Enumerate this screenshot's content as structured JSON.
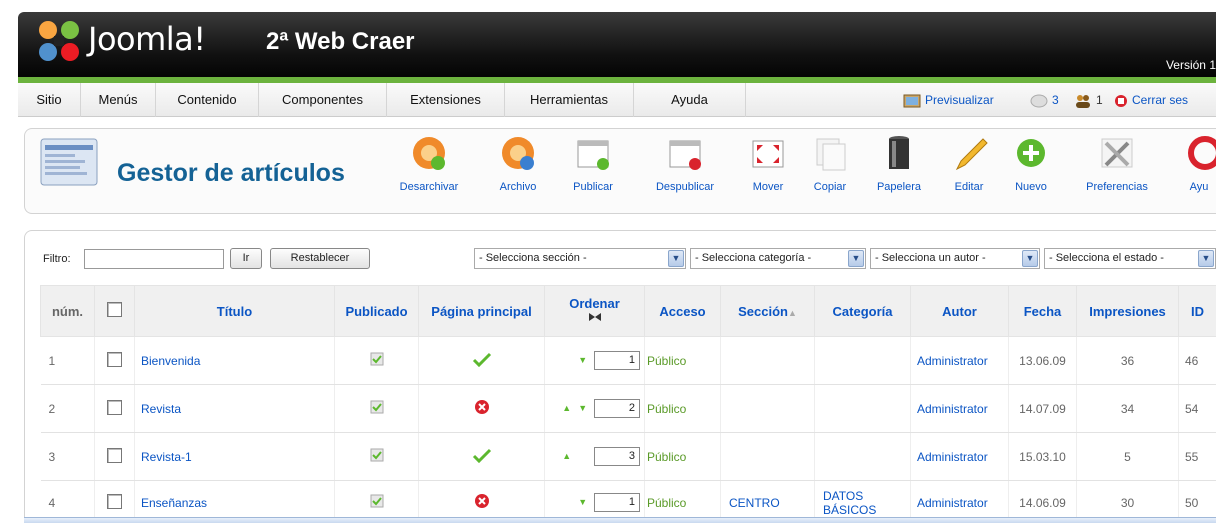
{
  "header": {
    "brand": "Joomla!",
    "site_name": "2ª Web Craer",
    "version": "Versión 1"
  },
  "menu": {
    "items": [
      "Sitio",
      "Menús",
      "Contenido",
      "Componentes",
      "Extensiones",
      "Herramientas",
      "Ayuda"
    ],
    "preview": "Previsualizar",
    "messages_count": "3",
    "users_count": "1",
    "logout": "Cerrar ses"
  },
  "toolbar": {
    "title": "Gestor de artículos",
    "buttons": [
      "Desarchivar",
      "Archivo",
      "Publicar",
      "Despublicar",
      "Mover",
      "Copiar",
      "Papelera",
      "Editar",
      "Nuevo",
      "Preferencias",
      "Ayu"
    ]
  },
  "filter": {
    "label": "Filtro:",
    "value": "",
    "go_button": "Ir",
    "reset_button": "Restablecer",
    "section_select": "- Selecciona sección -",
    "category_select": "- Selecciona categoría -",
    "author_select": "- Selecciona un autor -",
    "state_select": "- Selecciona el estado -"
  },
  "table": {
    "headers": {
      "num": "núm.",
      "title": "Título",
      "published": "Publicado",
      "frontpage": "Página principal",
      "order": "Ordenar",
      "access": "Acceso",
      "section": "Sección",
      "category": "Categoría",
      "author": "Autor",
      "date": "Fecha",
      "hits": "Impresiones",
      "id": "ID"
    },
    "rows": [
      {
        "num": "1",
        "title": "Bienvenida",
        "frontpage": "yes",
        "order": "1",
        "access": "Público",
        "section": "",
        "category": "",
        "author": "Administrator",
        "date": "13.06.09",
        "hits": "36",
        "id": "46"
      },
      {
        "num": "2",
        "title": "Revista",
        "frontpage": "no",
        "order": "2",
        "access": "Público",
        "section": "",
        "category": "",
        "author": "Administrator",
        "date": "14.07.09",
        "hits": "34",
        "id": "54"
      },
      {
        "num": "3",
        "title": "Revista-1",
        "frontpage": "yes",
        "order": "3",
        "access": "Público",
        "section": "",
        "category": "",
        "author": "Administrator",
        "date": "15.03.10",
        "hits": "5",
        "id": "55"
      },
      {
        "num": "4",
        "title": "Enseñanzas",
        "frontpage": "no",
        "order": "1",
        "access": "Público",
        "section": "CENTRO",
        "category": "DATOS BÁSICOS",
        "author": "Administrator",
        "date": "14.06.09",
        "hits": "30",
        "id": "50"
      }
    ]
  },
  "colors": {
    "accent_green": "#6cb33e",
    "link_blue": "#0b55c4",
    "title_blue": "#146295"
  }
}
